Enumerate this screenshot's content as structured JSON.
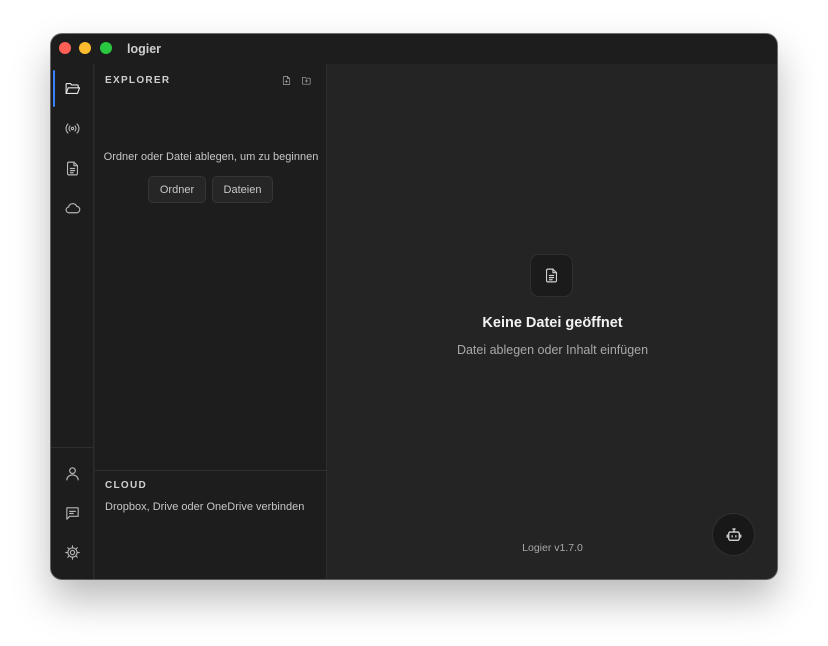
{
  "window": {
    "title": "logier"
  },
  "activity_bar": {
    "top_items": [
      {
        "icon": "folder-open-icon",
        "active": true
      },
      {
        "icon": "broadcast-icon",
        "active": false
      },
      {
        "icon": "document-icon",
        "active": false
      },
      {
        "icon": "cloud-icon",
        "active": false
      }
    ],
    "bottom_items": [
      {
        "icon": "user-icon"
      },
      {
        "icon": "message-icon"
      },
      {
        "icon": "gear-icon"
      }
    ],
    "accent_color": "#3b82f6"
  },
  "explorer": {
    "title": "EXPLORER",
    "new_file_icon": "new-file-icon",
    "new_folder_icon": "new-folder-icon",
    "drop_hint": "Ordner oder Datei ablegen, um zu beginnen",
    "folder_button": "Ordner",
    "files_button": "Dateien"
  },
  "cloud": {
    "title": "CLOUD",
    "hint": "Dropbox, Drive oder OneDrive verbinden"
  },
  "main": {
    "empty_icon": "document-icon",
    "empty_title": "Keine Datei geöffnet",
    "empty_subtitle": "Datei ablegen oder Inhalt einfügen",
    "version": "Logier v1.7.0",
    "assistant_icon": "robot-icon"
  }
}
